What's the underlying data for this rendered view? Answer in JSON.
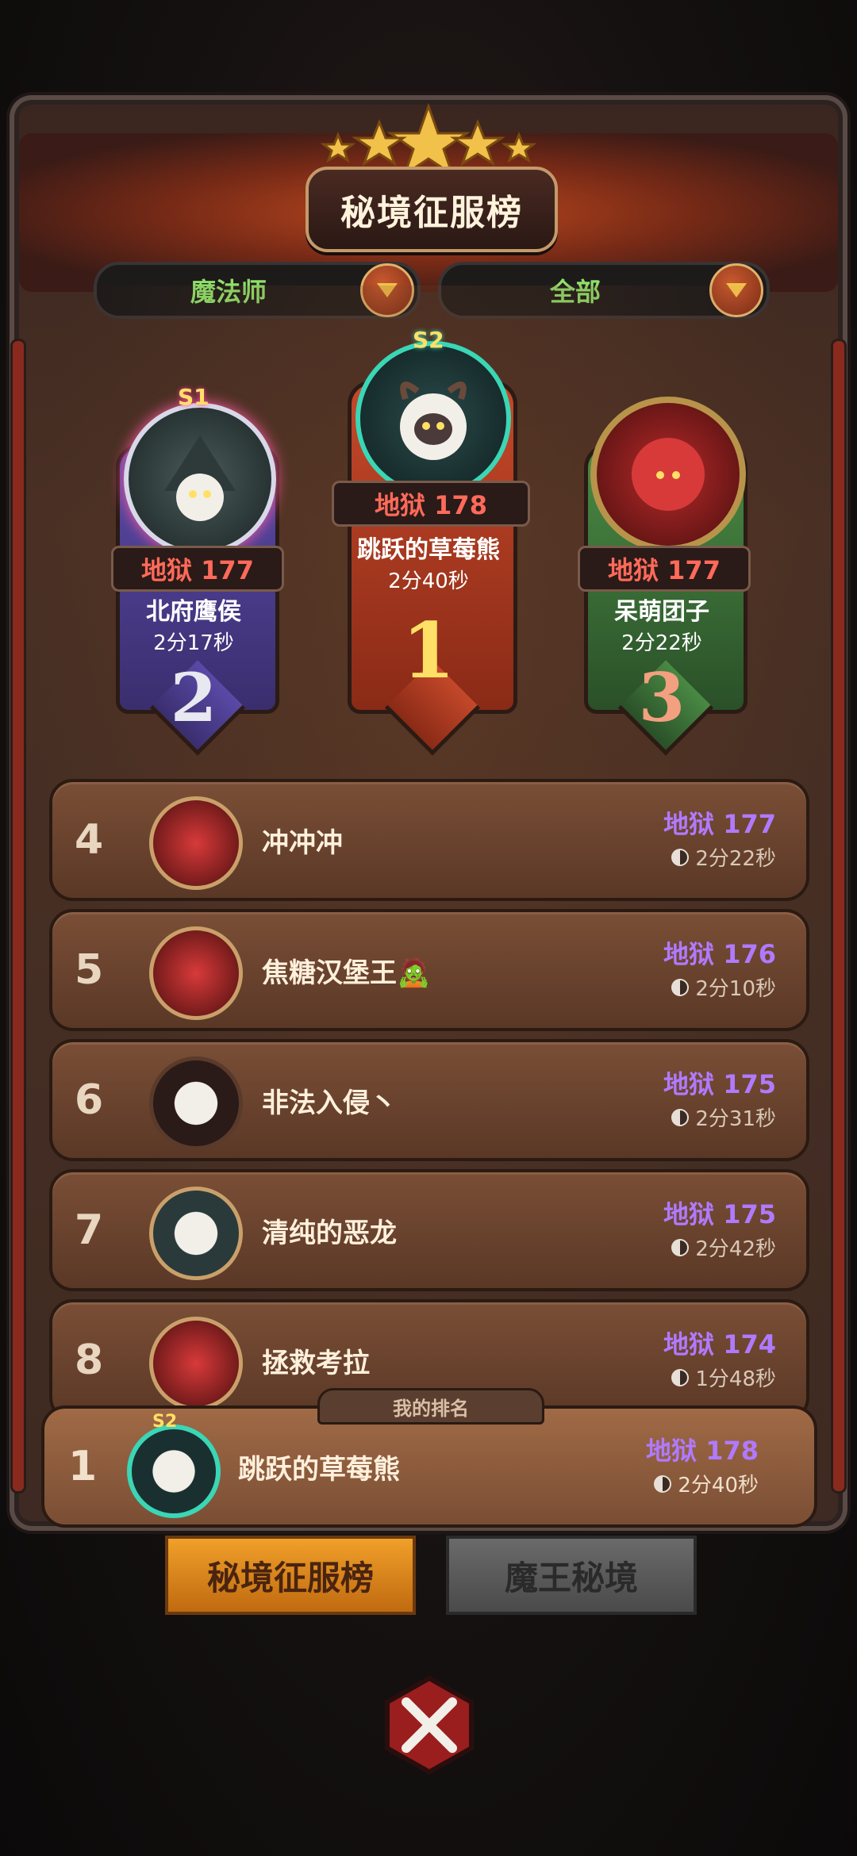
{
  "title": "秘境征服榜",
  "filters": {
    "class_label": "魔法师",
    "scope_label": "全部"
  },
  "podium": [
    {
      "rank": "2",
      "season": "S1",
      "score": "地狱 177",
      "name": "北府鹰侯",
      "time": "2分17秒",
      "color": "#4a3a8a"
    },
    {
      "rank": "1",
      "season": "S2",
      "score": "地狱 178",
      "name": "跳跃的草莓熊",
      "time": "2分40秒",
      "color": "#a8381e"
    },
    {
      "rank": "3",
      "season": "",
      "score": "地狱 177",
      "name": "呆萌团子",
      "time": "2分22秒",
      "color": "#3a6a34"
    }
  ],
  "rows": [
    {
      "rank": "4",
      "name": "冲冲冲",
      "score": "地狱 177",
      "time": "2分22秒",
      "avatar": "red-demon-icon"
    },
    {
      "rank": "5",
      "name": "焦糖汉堡王🧟",
      "score": "地狱 176",
      "time": "2分10秒",
      "avatar": "red-demon-icon"
    },
    {
      "rank": "6",
      "name": "非法入侵丶",
      "score": "地狱 175",
      "time": "2分31秒",
      "avatar": "white-sheep-icon"
    },
    {
      "rank": "7",
      "name": "清纯的恶龙",
      "score": "地狱 175",
      "time": "2分42秒",
      "avatar": "white-sheep-icon"
    },
    {
      "rank": "8",
      "name": "拯救考拉",
      "score": "地狱 174",
      "time": "1分48秒",
      "avatar": "red-demon-icon"
    }
  ],
  "my_rank": {
    "tab_label": "我的排名",
    "rank": "1",
    "season": "S2",
    "name": "跳跃的草莓熊",
    "score": "地狱 178",
    "time": "2分40秒"
  },
  "bottom_tabs": {
    "active": "秘境征服榜",
    "inactive": "魔王秘境"
  },
  "colors": {
    "score_purple": "#b07aff",
    "score_red": "#ff6a5a",
    "filter_green": "#8ee06a"
  }
}
